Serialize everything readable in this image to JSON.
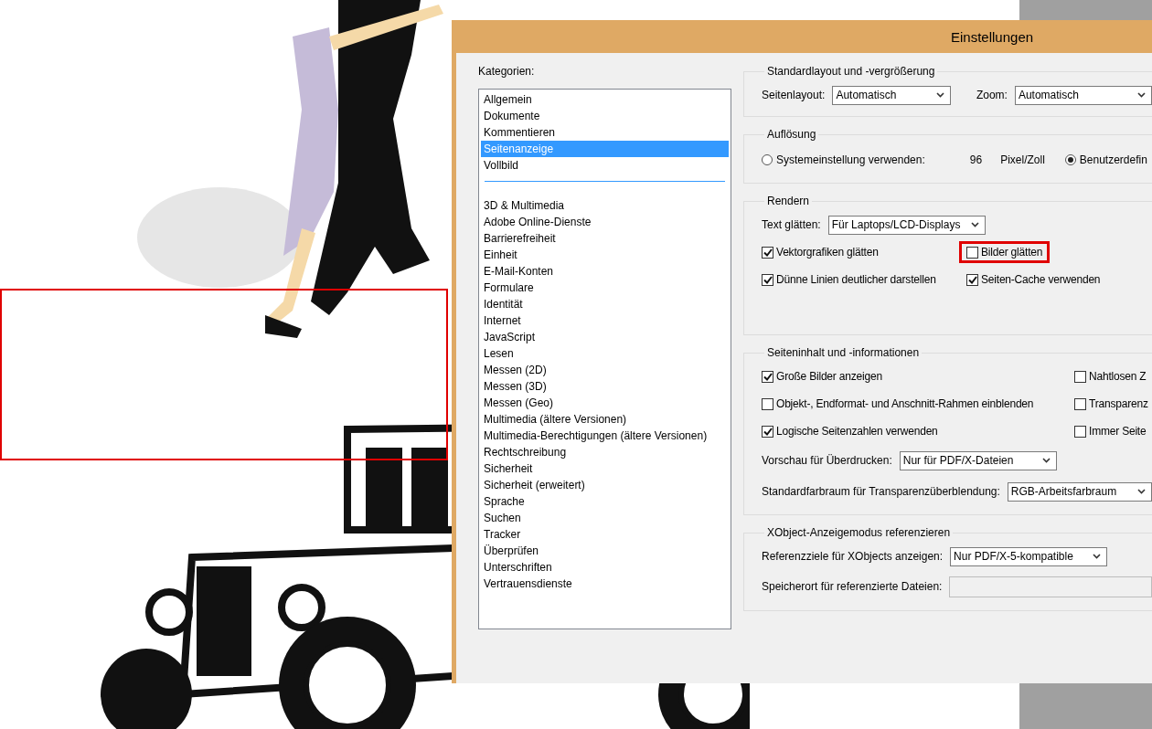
{
  "dialog": {
    "title": "Einstellungen"
  },
  "categories": {
    "label": "Kategorien:",
    "groups": [
      [
        {
          "label": "Allgemein",
          "selected": false
        },
        {
          "label": "Dokumente",
          "selected": false
        },
        {
          "label": "Kommentieren",
          "selected": false
        },
        {
          "label": "Seitenanzeige",
          "selected": true
        },
        {
          "label": "Vollbild",
          "selected": false
        }
      ],
      [
        {
          "label": "3D & Multimedia",
          "selected": false
        },
        {
          "label": "Adobe Online-Dienste",
          "selected": false
        },
        {
          "label": "Barrierefreiheit",
          "selected": false
        },
        {
          "label": "Einheit",
          "selected": false
        },
        {
          "label": "E-Mail-Konten",
          "selected": false
        },
        {
          "label": "Formulare",
          "selected": false
        },
        {
          "label": "Identität",
          "selected": false
        },
        {
          "label": "Internet",
          "selected": false
        },
        {
          "label": "JavaScript",
          "selected": false
        },
        {
          "label": "Lesen",
          "selected": false
        },
        {
          "label": "Messen (2D)",
          "selected": false
        },
        {
          "label": "Messen (3D)",
          "selected": false
        },
        {
          "label": "Messen (Geo)",
          "selected": false
        },
        {
          "label": "Multimedia (ältere Versionen)",
          "selected": false
        },
        {
          "label": "Multimedia-Berechtigungen (ältere Versionen)",
          "selected": false
        },
        {
          "label": "Rechtschreibung",
          "selected": false
        },
        {
          "label": "Sicherheit",
          "selected": false
        },
        {
          "label": "Sicherheit (erweitert)",
          "selected": false
        },
        {
          "label": "Sprache",
          "selected": false
        },
        {
          "label": "Suchen",
          "selected": false
        },
        {
          "label": "Tracker",
          "selected": false
        },
        {
          "label": "Überprüfen",
          "selected": false
        },
        {
          "label": "Unterschriften",
          "selected": false
        },
        {
          "label": "Vertrauensdienste",
          "selected": false
        }
      ]
    ]
  },
  "sections": [
    {
      "title": "Standardlayout und -vergrößerung",
      "rows": [
        {
          "kind": "selects",
          "fields": [
            {
              "label": "Seitenlayout:",
              "value": "Automatisch"
            },
            {
              "label": "Zoom:",
              "value": "Automatisch"
            }
          ]
        }
      ]
    },
    {
      "title": "Auflösung",
      "rows": [
        {
          "kind": "radios",
          "options": [
            {
              "label": "Systemeinstellung verwenden:",
              "selected": false,
              "value": "96",
              "unit": "Pixel/Zoll"
            },
            {
              "label": "Benutzerdefin",
              "selected": true
            }
          ]
        }
      ]
    },
    {
      "title": "Rendern",
      "rows": [
        {
          "kind": "selects",
          "fields": [
            {
              "label": "Text glätten:",
              "value": "Für Laptops/LCD-Displays"
            }
          ]
        },
        {
          "kind": "checks",
          "items": [
            {
              "label": "Vektorgrafiken glätten",
              "checked": true,
              "highlighted": false
            },
            {
              "label": "Bilder glätten",
              "checked": false,
              "highlighted": true
            }
          ]
        },
        {
          "kind": "checks",
          "items": [
            {
              "label": "Dünne Linien deutlicher darstellen",
              "checked": true,
              "highlighted": false
            },
            {
              "label": "Seiten-Cache verwenden",
              "checked": true,
              "highlighted": false
            }
          ]
        }
      ]
    },
    {
      "title": "Seiteninhalt und -informationen",
      "rows": [
        {
          "kind": "checks",
          "items": [
            {
              "label": "Große Bilder anzeigen",
              "checked": true,
              "highlighted": false
            },
            {
              "label": "Nahtlosen Z",
              "checked": false,
              "highlighted": false
            }
          ]
        },
        {
          "kind": "checks",
          "items": [
            {
              "label": "Objekt-, Endformat- und Anschnitt-Rahmen einblenden",
              "checked": false,
              "highlighted": false
            },
            {
              "label": "Transparenz",
              "checked": false,
              "highlighted": false
            }
          ]
        },
        {
          "kind": "checks",
          "items": [
            {
              "label": "Logische Seitenzahlen verwenden",
              "checked": true,
              "highlighted": false
            },
            {
              "label": "Immer Seite",
              "checked": false,
              "highlighted": false
            }
          ]
        },
        {
          "kind": "selects",
          "fields": [
            {
              "label": "Vorschau für Überdrucken:",
              "value": "Nur für PDF/X-Dateien"
            }
          ]
        },
        {
          "kind": "selects",
          "fields": [
            {
              "label": "Standardfarbraum für Transparenzüberblendung:",
              "value": "RGB-Arbeitsfarbraum"
            }
          ]
        }
      ]
    },
    {
      "title": "XObject-Anzeigemodus referenzieren",
      "rows": [
        {
          "kind": "selects",
          "fields": [
            {
              "label": "Referenzziele für XObjects anzeigen:",
              "value": "Nur PDF/X-5-kompatible"
            }
          ]
        },
        {
          "kind": "field",
          "label": "Speicherort für referenzierte Dateien:",
          "disabled": true
        }
      ]
    }
  ]
}
